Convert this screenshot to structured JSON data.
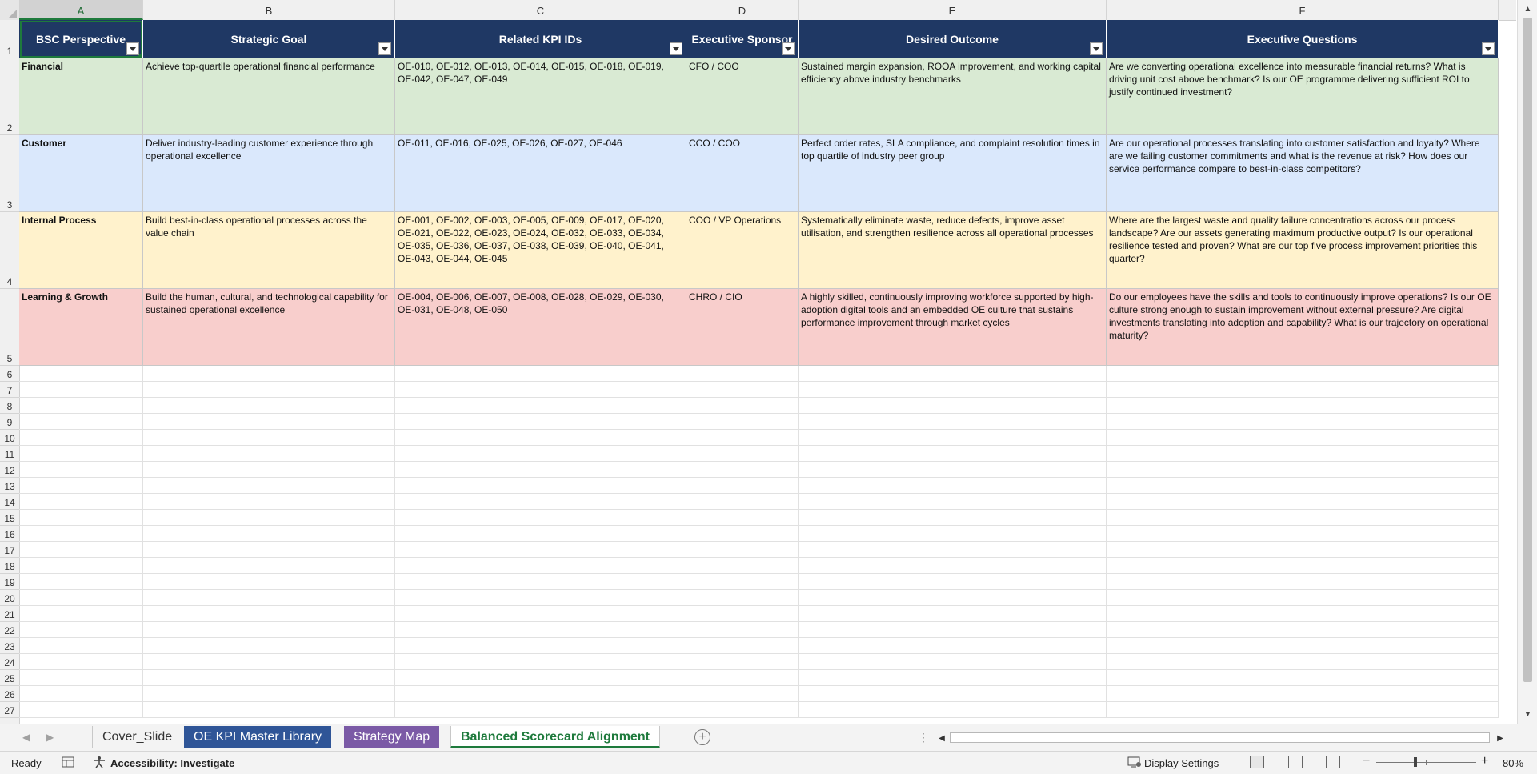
{
  "columns": [
    "A",
    "B",
    "C",
    "D",
    "E",
    "F"
  ],
  "row_numbers": [
    "1",
    "2",
    "3",
    "4",
    "5",
    "6",
    "7",
    "8",
    "9",
    "10",
    "11",
    "12",
    "13",
    "14",
    "15",
    "16",
    "17",
    "18",
    "19",
    "20",
    "21",
    "22",
    "23",
    "24",
    "25",
    "26",
    "27"
  ],
  "headers": [
    "BSC Perspective",
    "Strategic Goal",
    "Related KPI IDs",
    "Executive Sponsor",
    "Desired Outcome",
    "Executive Questions"
  ],
  "rows": [
    {
      "perspective": "Financial",
      "goal": "Achieve top-quartile operational financial performance",
      "kpis": "OE-010, OE-012, OE-013, OE-014, OE-015, OE-018, OE-019, OE-042, OE-047, OE-049",
      "sponsor": "CFO / COO",
      "outcome": "Sustained margin expansion, ROOA improvement, and working capital efficiency above industry benchmarks",
      "questions": "Are we converting operational excellence into measurable financial returns? What is driving unit cost above benchmark? Is our OE programme delivering sufficient ROI to justify continued investment?"
    },
    {
      "perspective": "Customer",
      "goal": "Deliver industry-leading customer experience through operational excellence",
      "kpis": "OE-011, OE-016, OE-025, OE-026, OE-027, OE-046",
      "sponsor": "CCO / COO",
      "outcome": "Perfect order rates, SLA compliance, and complaint resolution times in top quartile of industry peer group",
      "questions": "Are our operational processes translating into customer satisfaction and loyalty? Where are we failing customer commitments and what is the revenue at risk? How does our service performance compare to best-in-class competitors?"
    },
    {
      "perspective": "Internal Process",
      "goal": "Build best-in-class operational processes across the value chain",
      "kpis": "OE-001, OE-002, OE-003, OE-005, OE-009, OE-017, OE-020, OE-021, OE-022, OE-023, OE-024, OE-032, OE-033, OE-034, OE-035, OE-036, OE-037, OE-038, OE-039, OE-040, OE-041, OE-043, OE-044, OE-045",
      "sponsor": "COO / VP Operations",
      "outcome": "Systematically eliminate waste, reduce defects, improve asset utilisation, and strengthen resilience across all operational processes",
      "questions": "Where are the largest waste and quality failure concentrations across our process landscape? Are our assets generating maximum productive output? Is our operational resilience tested and proven? What are our top five process improvement priorities this quarter?"
    },
    {
      "perspective": "Learning & Growth",
      "goal": "Build the human, cultural, and technological capability for sustained operational excellence",
      "kpis": "OE-004, OE-006, OE-007, OE-008, OE-028, OE-029, OE-030, OE-031, OE-048, OE-050",
      "sponsor": "CHRO / CIO",
      "outcome": "A highly skilled, continuously improving workforce supported by high-adoption digital tools and an embedded OE culture that sustains performance improvement through market cycles",
      "questions": "Do our employees have the skills and tools to continuously improve operations? Is our OE culture strong enough to sustain improvement without external pressure? Are digital investments translating into adoption and capability? What is our trajectory on operational maturity?"
    }
  ],
  "row_colors": [
    "#d9ead3",
    "#dae8fc",
    "#fff2cc",
    "#f8cecc"
  ],
  "header_color": "#1f3864",
  "sheet_tabs": {
    "cover": "Cover_Slide",
    "kpi": "OE KPI Master Library",
    "strategy": "Strategy Map",
    "bsc": "Balanced Scorecard Alignment"
  },
  "status": {
    "ready": "Ready",
    "accessibility": "Accessibility: Investigate",
    "display_settings": "Display Settings",
    "zoom": "80%"
  }
}
